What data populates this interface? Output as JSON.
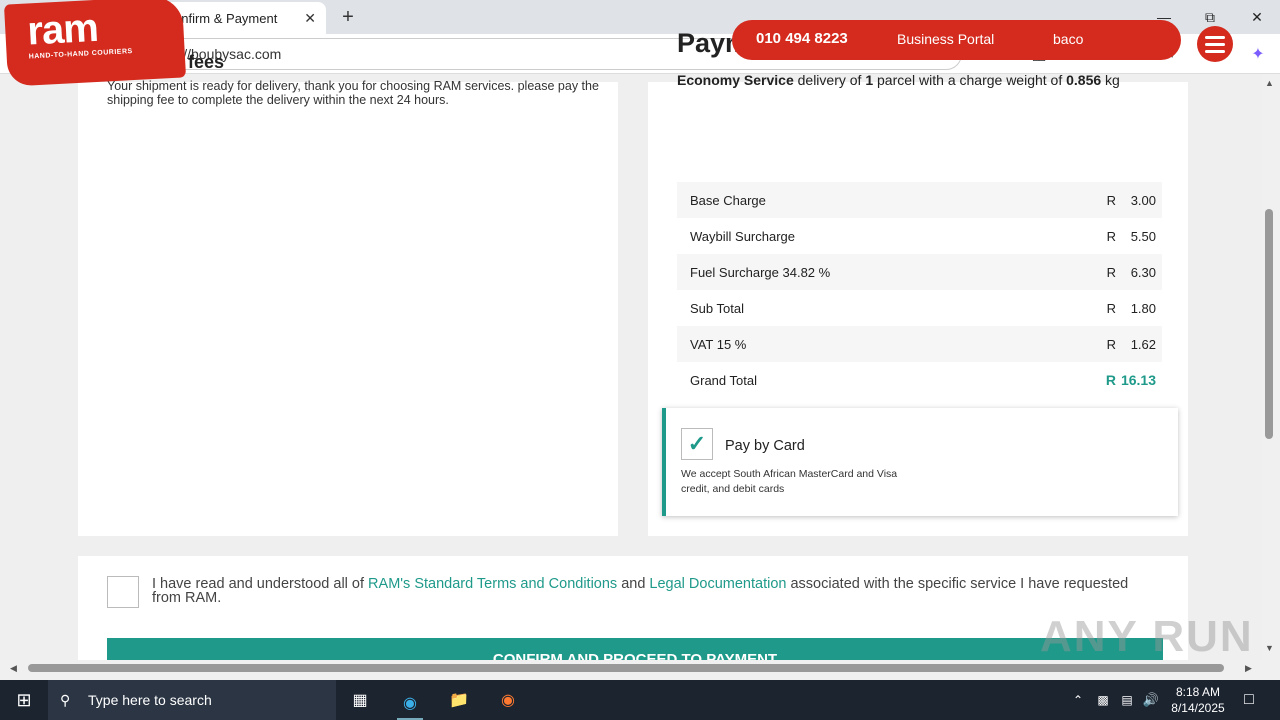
{
  "browser": {
    "tab_title": "RAM - Confirm & Payment",
    "url": "https://boubysac.com",
    "icons": [
      "profile-icon",
      "tab-actions-icon",
      "globe-icon",
      "close-icon",
      "new-tab-icon",
      "back-icon",
      "refresh-icon",
      "lock-icon",
      "read-aloud-icon",
      "favorite-icon",
      "extensions-icon",
      "split-screen-icon",
      "favorites-icon",
      "collections-icon",
      "performance-icon",
      "more-icon",
      "copilot-icon"
    ]
  },
  "logo": {
    "word": "ram",
    "tagline": "HAND-TO-HAND COURIERS"
  },
  "header": {
    "phone": "010 494 8223",
    "business_portal": "Business Portal",
    "user": "baco"
  },
  "shipping": {
    "title": "Shipping fees",
    "message": "Your shipment is ready for delivery, thank you for choosing RAM services. please pay the shipping fee to complete the delivery within the next 24 hours."
  },
  "payment": {
    "title": "Payment",
    "service": "Economy Service",
    "desc_1": " delivery of ",
    "parcels": "1",
    "desc_2": " parcel with a charge weight of ",
    "weight": "0.856",
    "unit": " kg",
    "rows": [
      {
        "label": "Base Charge",
        "currency": "R",
        "amount": "3.00"
      },
      {
        "label": "Waybill Surcharge",
        "currency": "R",
        "amount": "5.50"
      },
      {
        "label": "Fuel Surcharge 34.82 %",
        "currency": "R",
        "amount": "6.30"
      },
      {
        "label": "Sub Total",
        "currency": "R",
        "amount": "1.80"
      },
      {
        "label": "VAT 15 %",
        "currency": "R",
        "amount": "1.62"
      },
      {
        "label": "Grand Total",
        "currency": "R",
        "amount": "16.13"
      }
    ],
    "method_label": "Pay by Card",
    "method_note": "We accept South African MasterCard and Visa credit, and debit cards",
    "method_checked": true
  },
  "terms": {
    "pre": "I have read and understood all of ",
    "link1": "RAM's Standard Terms and Conditions",
    "mid": " and ",
    "link2": "Legal Documentation",
    "post": " associated with the specific service I have requested from RAM."
  },
  "cta_label": "CONFIRM AND PROCEED TO PAYMENT",
  "watermark": "ANY RUN",
  "taskbar": {
    "search_placeholder": "Type here to search",
    "time": "8:18 AM",
    "date": "8/14/2025"
  },
  "colors": {
    "brand_red": "#d42b1e",
    "accent_teal": "#1f9a8a"
  }
}
